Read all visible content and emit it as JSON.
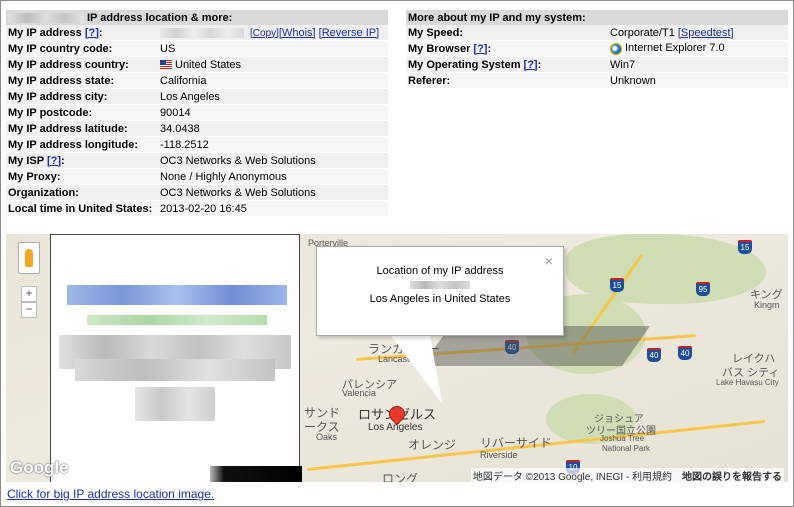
{
  "left_table": {
    "header": "IP address location & more:",
    "ip_label": "My IP address",
    "ip_help": "[?]",
    "ip_links": [
      "[Copy]",
      "[Whois]",
      "[Reverse IP]"
    ],
    "rows": [
      {
        "label": "My IP country code:",
        "value": "US"
      },
      {
        "label": "My IP address country:",
        "value": "United States"
      },
      {
        "label": "My IP address state:",
        "value": "California"
      },
      {
        "label": "My IP address city:",
        "value": "Los Angeles"
      },
      {
        "label": "My IP postcode:",
        "value": "90014"
      },
      {
        "label": "My IP address latitude:",
        "value": "34.0438"
      },
      {
        "label": "My IP address longitude:",
        "value": "-118.2512"
      },
      {
        "label": "My ISP",
        "help": "[?]",
        "value": "OC3 Networks & Web Solutions"
      },
      {
        "label": "My Proxy:",
        "value": "None / Highly Anonymous"
      },
      {
        "label": "Organization:",
        "value": "OC3 Networks & Web Solutions"
      },
      {
        "label": "Local time in United States:",
        "value": "2013-02-20 16:45"
      }
    ]
  },
  "right_table": {
    "header": "More about my IP and my system:",
    "speed_label": "My Speed:",
    "speed_value": "Corporate/T1",
    "speed_link": "[Speedtest]",
    "browser_label": "My Browser",
    "browser_help": "[?]",
    "browser_value": "Internet Explorer 7.0",
    "os_label": "My Operating System",
    "os_help": "[?]",
    "os_value": "Win7",
    "referer_label": "Referer:",
    "referer_value": "Unknown"
  },
  "map": {
    "infowindow_title": "Location of my IP address",
    "infowindow_place": "Los Angeles in United States",
    "close": "×",
    "zoom_in": "+",
    "zoom_out": "−",
    "google_logo": "Google",
    "attribution": "地図データ ©2013 Google, INEGI - 利用規約",
    "report_error": "地図の誤りを報告する",
    "labels": {
      "porterville": "Porterville",
      "lancaster_jp": "ランカスター",
      "lancaster": "Lancaster",
      "palmdale_jp": "パレンシア",
      "valencia": "Valencia",
      "sand_jp": "サンド",
      "oaks_jp": "ークス",
      "oaks": "Oaks",
      "la_jp": "ロサンゼルス",
      "la": "Los Angeles",
      "orange_jp": "オレンジ",
      "riverside_jp": "リバーサイド",
      "riverside": "Riverside",
      "long_jp": "ロング",
      "joshua_jp": "ジョシュア",
      "joshua_jp2": "ツリー国立公園",
      "joshua": "Joshua Tree",
      "joshua2": "National Park",
      "kingman_jp": "キング",
      "kingman": "Kingm",
      "havasu_jp": "レイクハ",
      "havasu_jp2": "バス シティ",
      "havasu": "Lake Havasu City"
    },
    "shields": [
      "15",
      "95",
      "40",
      "40",
      "40",
      "15",
      "10"
    ]
  },
  "footer_link": "Click for big IP address location image."
}
